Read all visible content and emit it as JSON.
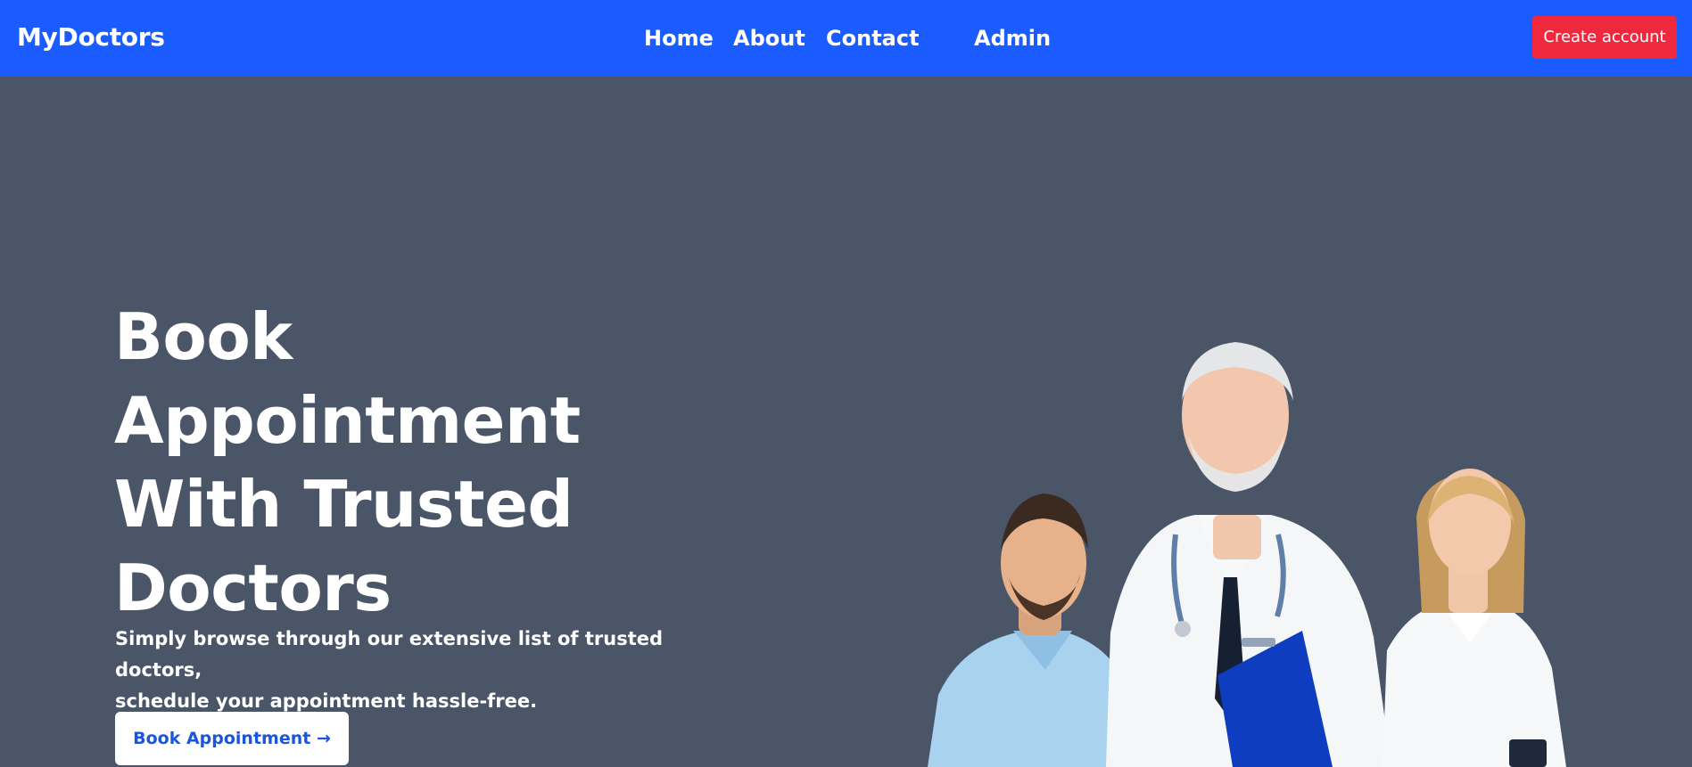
{
  "navbar": {
    "brand": "MyDoctors",
    "links": [
      {
        "label": "Home"
      },
      {
        "label": "About"
      },
      {
        "label": "Contact"
      },
      {
        "label": "Admin"
      }
    ],
    "cta_label": "Create account"
  },
  "hero": {
    "title_lines": [
      "Book",
      "Appointment",
      "With Trusted",
      "Doctors"
    ],
    "subtitle_lines": [
      "Simply browse through our extensive list of trusted doctors,",
      "schedule your appointment hassle-free."
    ],
    "button_label": "Book Appointment →",
    "image_subject": "three-doctors-photo"
  },
  "colors": {
    "navbar_bg": "#1a5cff",
    "cta_bg": "#f0283e",
    "hero_bg": "#4a5568",
    "hero_button_text": "#1a56db",
    "text": "#ffffff"
  }
}
